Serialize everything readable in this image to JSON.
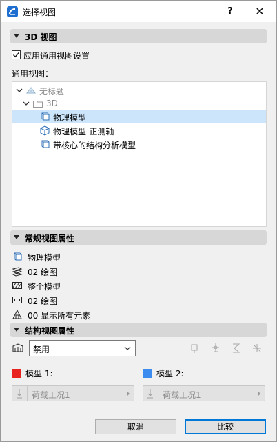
{
  "window": {
    "title": "选择视图",
    "help_label": "?",
    "close_label": "✕"
  },
  "section_3d": {
    "label": "3D 视图"
  },
  "use_generic": {
    "label": "应用通用视图设置",
    "checked": true
  },
  "generic_views_label": "通用视图：",
  "tree": {
    "items": [
      {
        "label": "无标题",
        "expanded": true,
        "disabled": true
      },
      {
        "label": "3D",
        "expanded": true,
        "disabled": true
      },
      {
        "label": "物理模型",
        "selected": true
      },
      {
        "label": "物理模型-正测轴",
        "selected": false
      },
      {
        "label": "带核心的结构分析模型",
        "selected": false
      }
    ]
  },
  "section_general": {
    "label": "常规视图属性"
  },
  "general_props": [
    {
      "icon": "model-view-icon",
      "label": "物理模型"
    },
    {
      "icon": "layer-combination-icon",
      "label": "02 绘图"
    },
    {
      "icon": "graphic-override-icon",
      "label": "整个模型"
    },
    {
      "icon": "pen-set-icon",
      "label": "02 绘图"
    },
    {
      "icon": "renovation-filter-icon",
      "label": "00 显示所有元素"
    }
  ],
  "section_structural": {
    "label": "结构视图属性"
  },
  "structural": {
    "mode_value": "禁用",
    "model1_label": "模型 1:",
    "model2_label": "模型 2:",
    "model1_load": "荷载工况1",
    "model2_load": "荷载工况1",
    "model1_color": "#e8221e",
    "model2_color": "#3c8cf0"
  },
  "buttons": {
    "cancel_label": "取消",
    "compare_label": "比较"
  }
}
